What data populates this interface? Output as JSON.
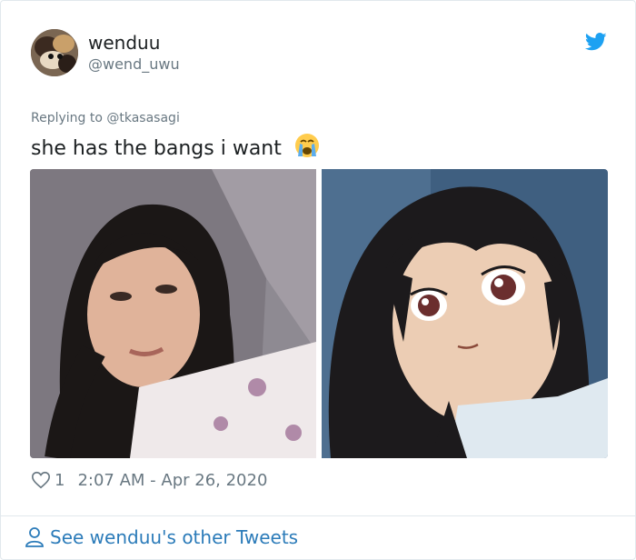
{
  "author": {
    "display_name": "wenduu",
    "handle": "@wend_uwu",
    "avatar_icon": "avatar-photo"
  },
  "tweet": {
    "replying_to": "Replying to @tkasasagi",
    "text": "she has the bangs i want",
    "emoji": "loudly-crying-face-emoji",
    "media": [
      {
        "kind": "photo",
        "alt_icon": "selfie-photo"
      },
      {
        "kind": "photo",
        "alt_icon": "anime-portrait"
      }
    ]
  },
  "meta": {
    "likes": "1",
    "timestamp": "2:07 AM - Apr 26, 2020"
  },
  "footer": {
    "see_more": "See wenduu's other Tweets"
  },
  "colors": {
    "brand_blue": "#1da1f2",
    "link_blue": "#2b7bb9",
    "muted_gray": "#697882",
    "border": "#e1e8ed"
  }
}
